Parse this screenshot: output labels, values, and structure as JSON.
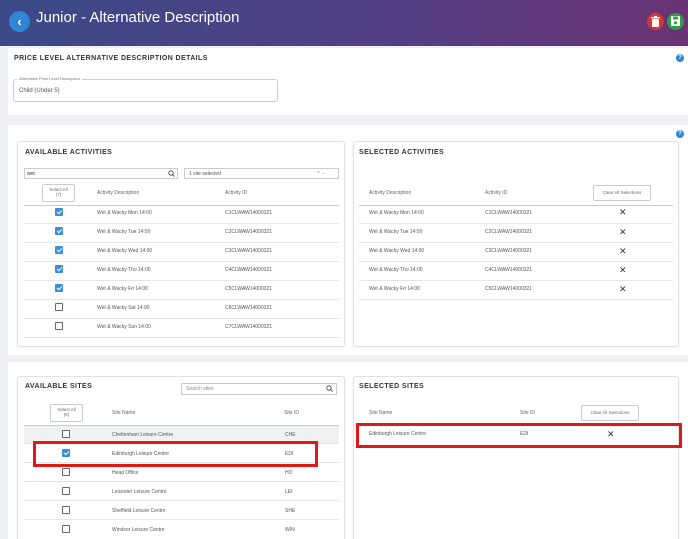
{
  "header": {
    "title": "Junior - Alternative Description"
  },
  "details": {
    "section_title": "PRICE LEVEL ALTERNATIVE DESCRIPTION DETAILS",
    "field_label": "Alternative Price Level Description",
    "field_value": "Child (Under 5)"
  },
  "available_activities": {
    "title": "AVAILABLE ACTIVITIES",
    "search_value": "wet",
    "site_filter": "1 site selected",
    "select_all_label": "Select All",
    "select_all_count": "(7)",
    "col_description": "Activity Description",
    "col_id": "Activity ID",
    "rows": [
      {
        "description": "Wet & Wacky Mon 14:00",
        "id": "C1CLWAW14000321",
        "checked": true
      },
      {
        "description": "Wet & Wacky Tue 14:00",
        "id": "C2CLWAW14000321",
        "checked": true
      },
      {
        "description": "Wet & Wacky Wed 14:00",
        "id": "C3CLWAW14000321",
        "checked": true
      },
      {
        "description": "Wet & Wacky Thu 14:00",
        "id": "C4CLWAW14000321",
        "checked": true
      },
      {
        "description": "Wet & Wacky Fri 14:00",
        "id": "C5CLWAW14000321",
        "checked": true
      },
      {
        "description": "Wet & Wacky Sat 14:00",
        "id": "C6CLWAW14000321",
        "checked": false
      },
      {
        "description": "Wet & Wacky Sun 14:00",
        "id": "C7CLWAW14000321",
        "checked": false
      }
    ]
  },
  "selected_activities": {
    "title": "SELECTED ACTIVITIES",
    "col_description": "Activity Description",
    "col_id": "Activity ID",
    "clear_label": "Clear All Selections",
    "rows": [
      {
        "description": "Wet & Wacky Mon 14:00",
        "id": "C1CLWAW14000321"
      },
      {
        "description": "Wet & Wacky Tue 14:00",
        "id": "C2CLWAW14000321"
      },
      {
        "description": "Wet & Wacky Wed 14:00",
        "id": "C3CLWAW14000321"
      },
      {
        "description": "Wet & Wacky Thu 14:00",
        "id": "C4CLWAW14000321"
      },
      {
        "description": "Wet & Wacky Fri 14:00",
        "id": "C5CLWAW14000321"
      }
    ]
  },
  "available_sites": {
    "title": "AVAILABLE SITES",
    "search_placeholder": "Search sites",
    "select_all_label": "Select All",
    "select_all_count": "(6)",
    "col_name": "Site Name",
    "col_id": "Site ID",
    "rows": [
      {
        "name": "Cheltenham Leisure Centre",
        "id": "CHE",
        "checked": false
      },
      {
        "name": "Edinburgh Leisure Centre",
        "id": "EDI",
        "checked": true
      },
      {
        "name": "Head Office",
        "id": "HO",
        "checked": false
      },
      {
        "name": "Leicester Leisure Centre",
        "id": "LEI",
        "checked": false
      },
      {
        "name": "Sheffield Leisure Centre",
        "id": "SHE",
        "checked": false
      },
      {
        "name": "Windsor Leisure Centre",
        "id": "WIN",
        "checked": false
      }
    ]
  },
  "selected_sites": {
    "title": "SELECTED SITES",
    "col_name": "Site Name",
    "col_id": "Site ID",
    "clear_label": "Clear All Selections",
    "rows": [
      {
        "name": "Edinburgh Leisure Centre",
        "id": "EDI"
      }
    ]
  },
  "colors": {
    "header_start": "#3b4a87",
    "header_end": "#6a3474",
    "accent": "#2f86d6",
    "delete": "#e03131",
    "save": "#2f9e44",
    "highlight": "#e01818"
  },
  "icons": {
    "back": "chevron-left-icon",
    "delete": "trash-icon",
    "save": "save-icon",
    "help": "help-icon",
    "search": "search-icon",
    "remove": "close-icon"
  }
}
